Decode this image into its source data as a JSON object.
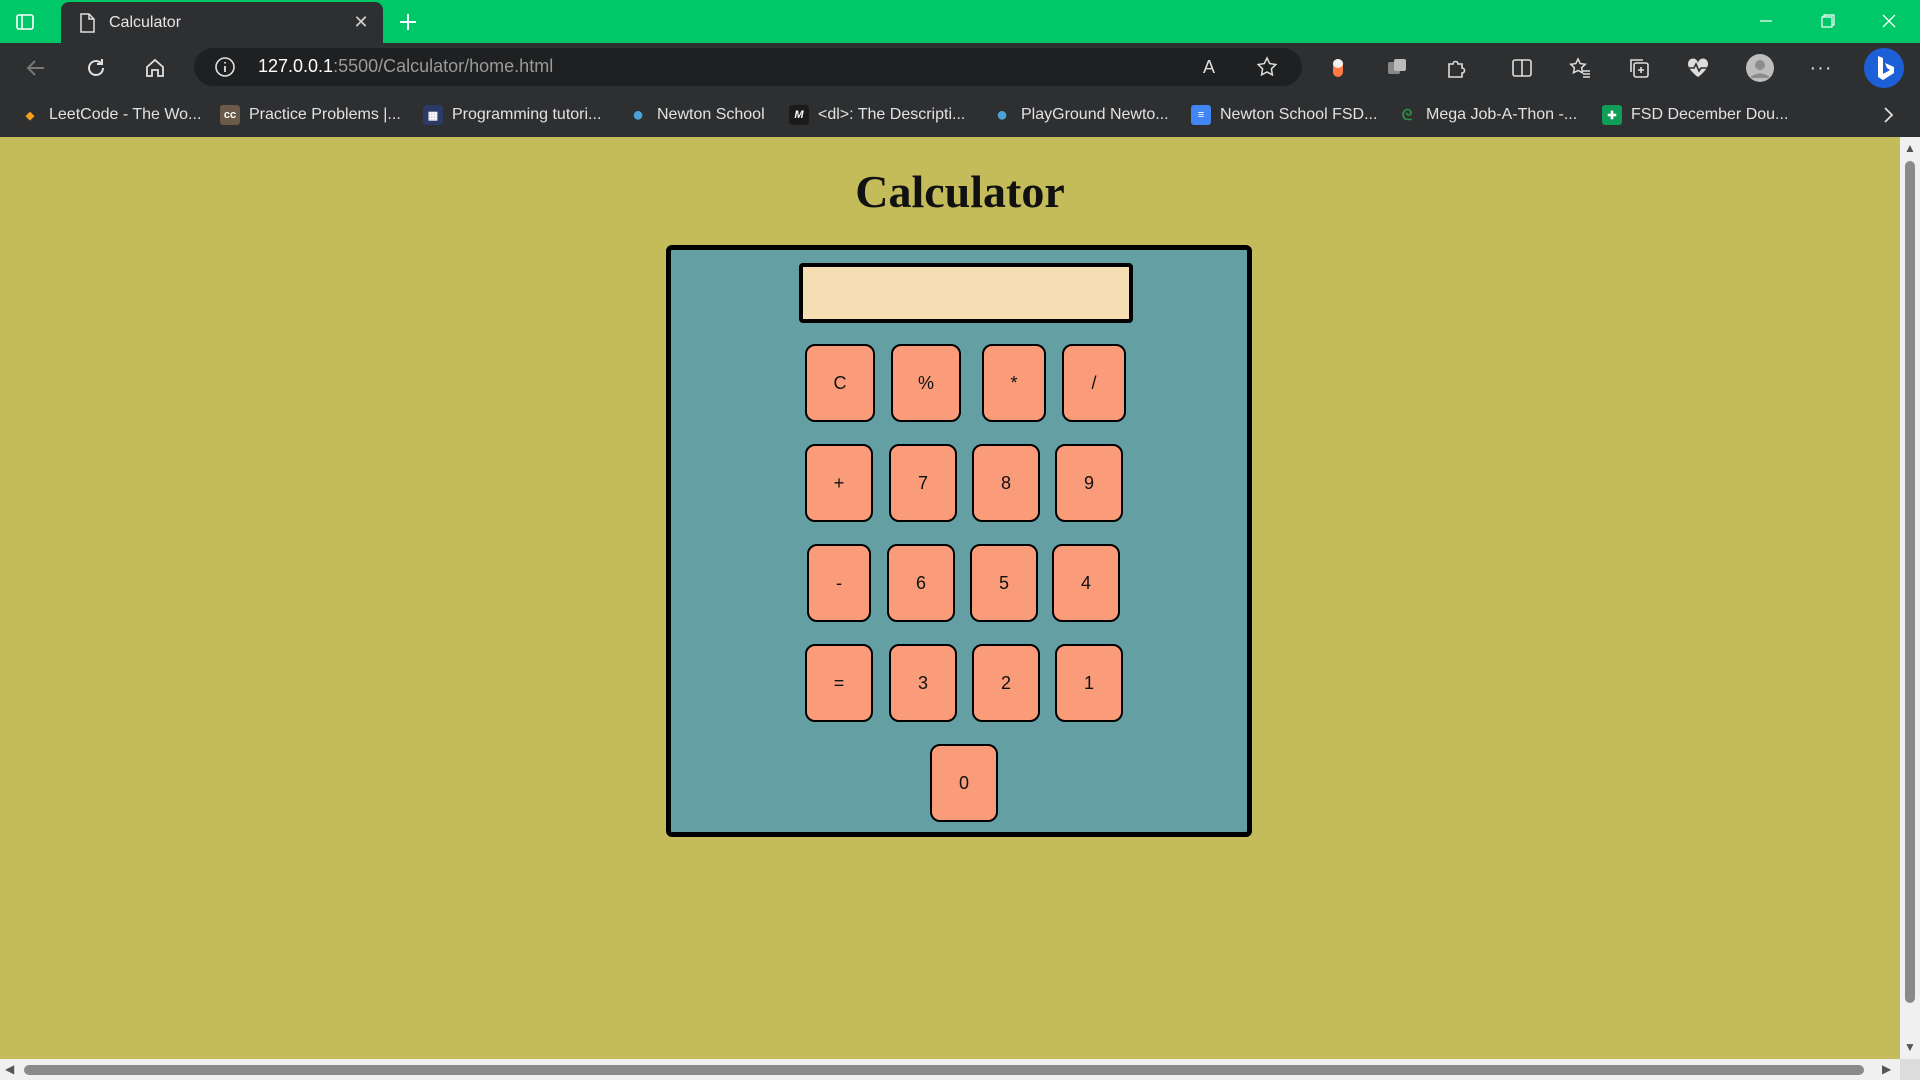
{
  "browser": {
    "tab_title": "Calculator",
    "url_host": "127.0.0.1",
    "url_path": ":5500/Calculator/home.html",
    "read_aloud_label": "A",
    "more_label": "···",
    "bookmarks": [
      {
        "label": "LeetCode - The Wo...",
        "icon": "leetcode-icon",
        "color": "#f89f1b",
        "glyph": "◆"
      },
      {
        "label": "Practice Problems |...",
        "icon": "codechef-icon",
        "color": "#6b5a4a",
        "glyph": "cc"
      },
      {
        "label": "Programming tutori...",
        "icon": "tutorial-icon",
        "color": "#2b3a67",
        "glyph": "▦"
      },
      {
        "label": "Newton School",
        "icon": "newton-icon",
        "color": "#49a3d6",
        "glyph": "●"
      },
      {
        "label": "<dl>: The Descripti...",
        "icon": "mdn-icon",
        "color": "#1b1b1b",
        "glyph": "M"
      },
      {
        "label": "PlayGround Newto...",
        "icon": "playground-icon",
        "color": "#49a3d6",
        "glyph": "●"
      },
      {
        "label": "Newton School FSD...",
        "icon": "docs-icon",
        "color": "#4285f4",
        "glyph": "≡"
      },
      {
        "label": "Mega Job-A-Thon -...",
        "icon": "gfg-icon",
        "color": "#2f8d46",
        "glyph": "ᘓ"
      },
      {
        "label": "FSD December Dou...",
        "icon": "sheets-icon",
        "color": "#0f9d58",
        "glyph": "✚"
      }
    ]
  },
  "page": {
    "heading": "Calculator",
    "display_value": ""
  },
  "calculator": {
    "keys": [
      "C",
      "%",
      "*",
      "/",
      "+",
      "7",
      "8",
      "9",
      "-",
      "6",
      "5",
      "4",
      "=",
      "3",
      "2",
      "1",
      "0"
    ]
  },
  "colors": {
    "page_bg": "#c4bc5a",
    "calc_bg": "#649fa3",
    "display_bg": "#f5deb3",
    "key_bg": "#fa9b7a",
    "titlebar": "#00c767"
  }
}
